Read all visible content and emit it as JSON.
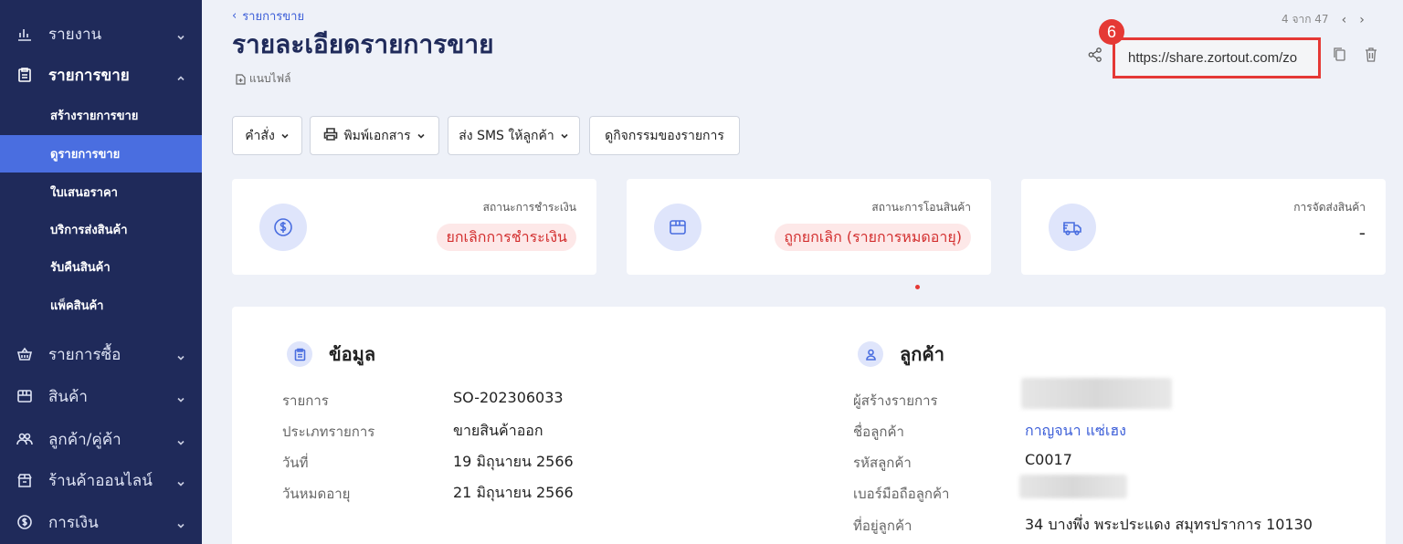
{
  "sidebar": {
    "items": [
      {
        "label": "รายงาน"
      },
      {
        "label": "รายการขาย"
      },
      {
        "label": "รายการซื้อ"
      },
      {
        "label": "สินค้า"
      },
      {
        "label": "ลูกค้า/คู่ค้า"
      },
      {
        "label": "ร้านค้าออนไลน์"
      },
      {
        "label": "การเงิน"
      }
    ],
    "sub_items": [
      {
        "label": "สร้างรายการขาย"
      },
      {
        "label": "ดูรายการขาย"
      },
      {
        "label": "ใบเสนอราคา"
      },
      {
        "label": "บริการส่งสินค้า"
      },
      {
        "label": "รับคืนสินค้า"
      },
      {
        "label": "แพ็คสินค้า"
      }
    ]
  },
  "header": {
    "back_label": "รายการขาย",
    "title": "รายละเอียดรายการขาย",
    "file_label": "แนบไฟล์",
    "pager_text": "4 จาก 47",
    "share_url": "https://share.zortout.com/zo",
    "badge_number": "6"
  },
  "actions": {
    "command": "คำสั่ง",
    "print": "พิมพ์เอกสาร",
    "sms": "ส่ง SMS ให้ลูกค้า",
    "activity": "ดูกิจกรรมของรายการ"
  },
  "status_cards": [
    {
      "label": "สถานะการชำระเงิน",
      "value": "ยกเลิกการชำระเงิน",
      "icon": "dollar-icon"
    },
    {
      "label": "สถานะการโอนสินค้า",
      "value": "ถูกยกเลิก (รายการหมดอายุ)",
      "icon": "box-icon"
    },
    {
      "label": "การจัดส่งสินค้า",
      "value": "-",
      "icon": "truck-icon"
    }
  ],
  "info": {
    "heading": "ข้อมูล",
    "rows": [
      {
        "label": "รายการ",
        "value": "SO-202306033"
      },
      {
        "label": "ประเภทรายการ",
        "value": "ขายสินค้าออก"
      },
      {
        "label": "วันที่",
        "value": "19 มิถุนายน 2566"
      },
      {
        "label": "วันหมดอายุ",
        "value": "21 มิถุนายน 2566"
      }
    ]
  },
  "customer": {
    "heading": "ลูกค้า",
    "rows": [
      {
        "label": "ผู้สร้างรายการ",
        "value": ""
      },
      {
        "label": "ชื่อลูกค้า",
        "value": "กาญจนา แซ่เฮง"
      },
      {
        "label": "รหัสลูกค้า",
        "value": "C0017"
      },
      {
        "label": "เบอร์มือถือลูกค้า",
        "value": ""
      },
      {
        "label": "ที่อยู่ลูกค้า",
        "value": "34 บางพึ่ง พระประแดง สมุทรปราการ 10130"
      }
    ]
  },
  "colors": {
    "sidebar": "#1f2a5a",
    "accent": "#4a6ee0",
    "highlight_border": "#e53935",
    "status_pill_bg": "#fde8e8",
    "status_pill_text": "#d32f2f"
  }
}
